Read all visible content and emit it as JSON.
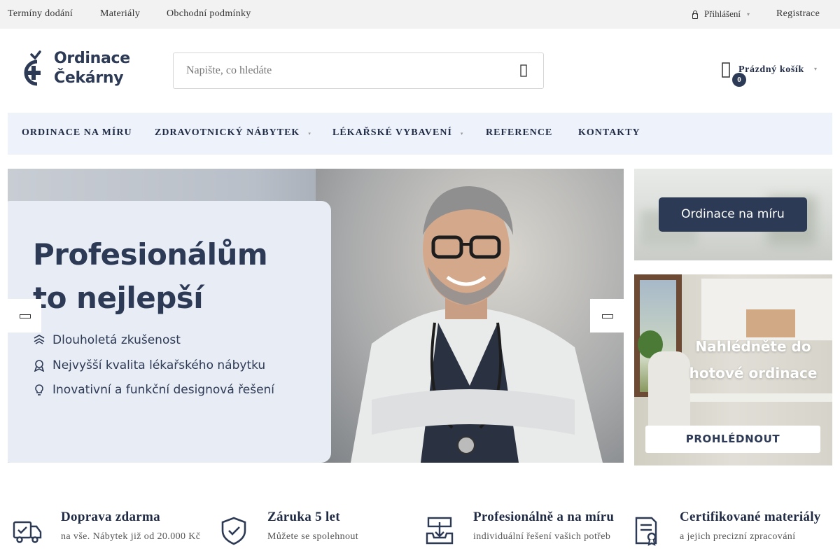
{
  "topbar": {
    "links": [
      "Termíny dodání",
      "Materiály",
      "Obchodní podmínky"
    ],
    "login": "Přihlášení",
    "register": "Registrace"
  },
  "logo": {
    "line1": "Ordinace",
    "line2": "Čekárny"
  },
  "search": {
    "placeholder": "Napište, co hledáte"
  },
  "cart": {
    "label": "Prázdný košík",
    "count": "0"
  },
  "nav": {
    "items": [
      {
        "label": "ORDINACE NA MÍRU"
      },
      {
        "label": "ZDRAVOTNICKÝ NÁBYTEK"
      },
      {
        "label": "LÉKAŘSKÉ VYBAVENÍ"
      },
      {
        "label": "REFERENCE"
      },
      {
        "label": "KONTAKTY"
      }
    ]
  },
  "hero": {
    "title_line1": "Profesionálům",
    "title_line2": "to nejlepší",
    "features": [
      "Dlouholetá zkušenost",
      "Nejvyšší kvalita lékařského nábytku",
      "Inovativní a funkční designová řešení"
    ]
  },
  "side_banners": {
    "top": {
      "button": "Ordinace na míru"
    },
    "bottom": {
      "title_line1": "Nahlédněte do",
      "title_line2": "hotové ordinace",
      "button": "PROHLÉDNOUT"
    }
  },
  "benefits": [
    {
      "icon": "truck-icon",
      "title": "Doprava zdarma",
      "desc": "na vše. Nábytek již od 20.000 Kč"
    },
    {
      "icon": "shield-check-icon",
      "title": "Záruka 5 let",
      "desc": "Můžete se spolehnout"
    },
    {
      "icon": "tray-download-icon",
      "title": "Profesionálně a na míru",
      "desc": "individuální řešení vašich potřeb"
    },
    {
      "icon": "certificate-icon",
      "title": "Certifikované materiály",
      "desc": "a jejich precizní zpracování"
    }
  ],
  "colors": {
    "brand": "#2d3a55",
    "nav_bg": "#eef3fb",
    "topbar_bg": "#f2f2f2"
  }
}
